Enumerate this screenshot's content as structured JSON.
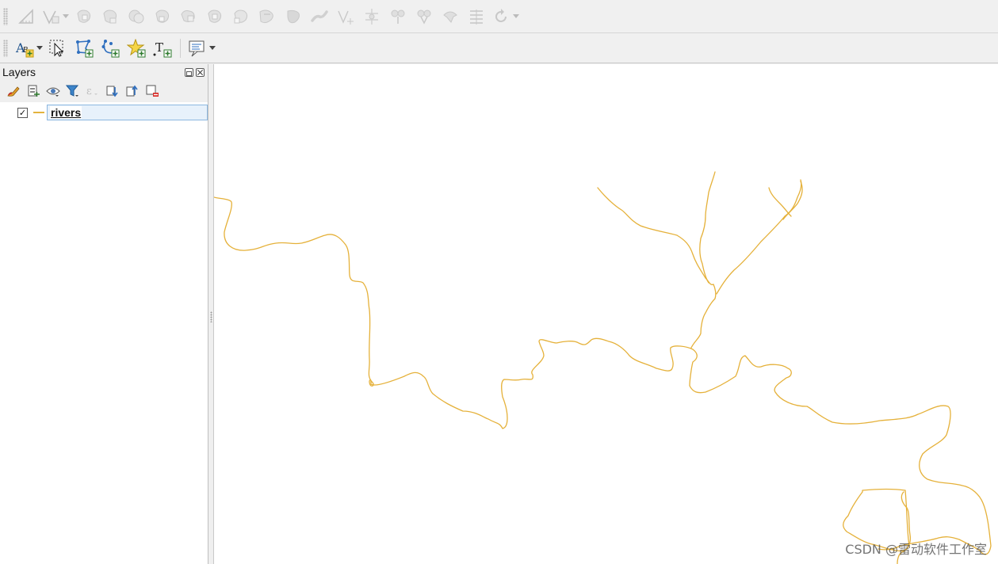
{
  "toolbar_top": {
    "buttons": [
      {
        "icon": "measure-icon",
        "enabled": false
      },
      {
        "icon": "vertex-tool-icon",
        "enabled": false,
        "dropdown": true
      },
      {
        "icon": "add-ring-icon",
        "enabled": false
      },
      {
        "icon": "add-part-icon",
        "enabled": false
      },
      {
        "icon": "fill-ring-icon",
        "enabled": false
      },
      {
        "icon": "delete-ring-icon",
        "enabled": false
      },
      {
        "icon": "delete-part-icon",
        "enabled": false
      },
      {
        "icon": "reshape-features-icon",
        "enabled": false
      },
      {
        "icon": "offset-curve-icon",
        "enabled": false
      },
      {
        "icon": "reverse-line-icon",
        "enabled": false
      },
      {
        "icon": "simplify-feature-icon",
        "enabled": false
      },
      {
        "icon": "split-features-icon",
        "enabled": false
      },
      {
        "icon": "split-parts-icon",
        "enabled": false
      },
      {
        "icon": "merge-features-icon",
        "enabled": false
      },
      {
        "icon": "merge-attributes-icon",
        "enabled": false
      },
      {
        "icon": "rotate-point-symbols-icon",
        "enabled": false
      },
      {
        "icon": "offset-point-symbols-icon",
        "enabled": false
      },
      {
        "icon": "trim-extend-icon",
        "enabled": false,
        "dropdown": true
      }
    ]
  },
  "toolbar_label": {
    "buttons": [
      {
        "icon": "layer-labeling-icon",
        "enabled": true,
        "dropdown": true
      },
      {
        "icon": "pin-unpin-labels-icon",
        "enabled": true
      },
      {
        "icon": "highlight-pinned-labels-icon",
        "enabled": true
      },
      {
        "icon": "move-label-icon",
        "enabled": true
      },
      {
        "icon": "rotate-label-icon",
        "enabled": true
      },
      {
        "icon": "change-label-icon",
        "enabled": true
      },
      {
        "icon": "show-hide-labels-icon",
        "enabled": true,
        "dropdown": true
      }
    ]
  },
  "layers_panel": {
    "title": "Layers",
    "toolbar": [
      {
        "icon": "layer-styling-icon",
        "enabled": true
      },
      {
        "icon": "add-group-icon",
        "enabled": true
      },
      {
        "icon": "manage-visibility-icon",
        "enabled": true,
        "dropdown": true
      },
      {
        "icon": "filter-legend-icon",
        "enabled": true,
        "dropdown": true
      },
      {
        "icon": "filter-expression-icon",
        "enabled": false,
        "dropdown": true
      },
      {
        "icon": "expand-all-icon",
        "enabled": true
      },
      {
        "icon": "collapse-all-icon",
        "enabled": true
      },
      {
        "icon": "remove-layer-icon",
        "enabled": true
      }
    ],
    "layers": [
      {
        "name": "rivers",
        "checked": true,
        "checkmark": "✓",
        "symbol_color": "#e3b33e"
      }
    ]
  },
  "map": {
    "background": "#ffffff",
    "river_color": "#e5b13a"
  },
  "watermark": "CSDN @雷动软件工作室"
}
